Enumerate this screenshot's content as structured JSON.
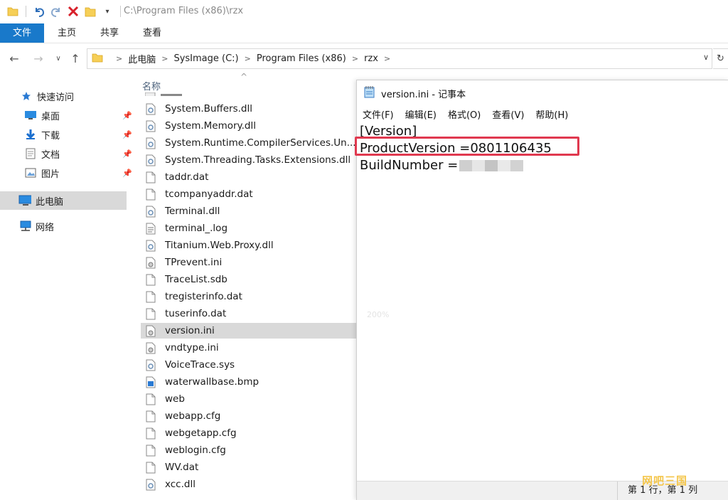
{
  "window": {
    "title_path": "C:\\Program Files (x86)\\rzx"
  },
  "ribbon": {
    "tabs": [
      "文件",
      "主页",
      "共享",
      "查看"
    ]
  },
  "address": {
    "crumbs": [
      "此电脑",
      "SysImage (C:)",
      "Program Files (x86)",
      "rzx"
    ]
  },
  "navpane": {
    "quick_access": "快速访问",
    "desktop": "桌面",
    "downloads": "下载",
    "documents": "文档",
    "pictures": "图片",
    "this_pc": "此电脑",
    "network": "网络"
  },
  "filelist": {
    "column_name": "名称",
    "files": [
      {
        "name": "System.Buffers.dll",
        "icon": "dll-icon"
      },
      {
        "name": "System.Memory.dll",
        "icon": "dll-icon"
      },
      {
        "name": "System.Runtime.CompilerServices.Un...",
        "icon": "dll-icon"
      },
      {
        "name": "System.Threading.Tasks.Extensions.dll",
        "icon": "dll-icon"
      },
      {
        "name": "taddr.dat",
        "icon": "file-icon"
      },
      {
        "name": "tcompanyaddr.dat",
        "icon": "file-icon"
      },
      {
        "name": "Terminal.dll",
        "icon": "dll-icon"
      },
      {
        "name": "terminal_.log",
        "icon": "text-icon"
      },
      {
        "name": "Titanium.Web.Proxy.dll",
        "icon": "dll-icon"
      },
      {
        "name": "TPrevent.ini",
        "icon": "ini-icon"
      },
      {
        "name": "TraceList.sdb",
        "icon": "file-icon"
      },
      {
        "name": "tregisterinfo.dat",
        "icon": "file-icon"
      },
      {
        "name": "tuserinfo.dat",
        "icon": "file-icon"
      },
      {
        "name": "version.ini",
        "icon": "ini-icon",
        "selected": true
      },
      {
        "name": "vndtype.ini",
        "icon": "ini-icon"
      },
      {
        "name": "VoiceTrace.sys",
        "icon": "dll-icon"
      },
      {
        "name": "waterwallbase.bmp",
        "icon": "image-icon"
      },
      {
        "name": "web",
        "icon": "file-icon"
      },
      {
        "name": "webapp.cfg",
        "icon": "file-icon"
      },
      {
        "name": "webgetapp.cfg",
        "icon": "file-icon"
      },
      {
        "name": "weblogin.cfg",
        "icon": "file-icon"
      },
      {
        "name": "WV.dat",
        "icon": "file-icon"
      },
      {
        "name": "xcc.dll",
        "icon": "dll-icon"
      }
    ]
  },
  "notepad": {
    "title": "version.ini - 记事本",
    "menu": [
      "文件(F)",
      "编辑(E)",
      "格式(O)",
      "查看(V)",
      "帮助(H)"
    ],
    "lines": [
      "[Version]",
      "ProductVersion =0801106435",
      "BuildNumber ="
    ],
    "zoom": "200%",
    "status_position": "第 1 行，第 1 列"
  },
  "watermark": "网吧三国",
  "colors": {
    "accent": "#1979ca",
    "highlight_box": "#e0394f",
    "selection": "#d9d9d9"
  }
}
